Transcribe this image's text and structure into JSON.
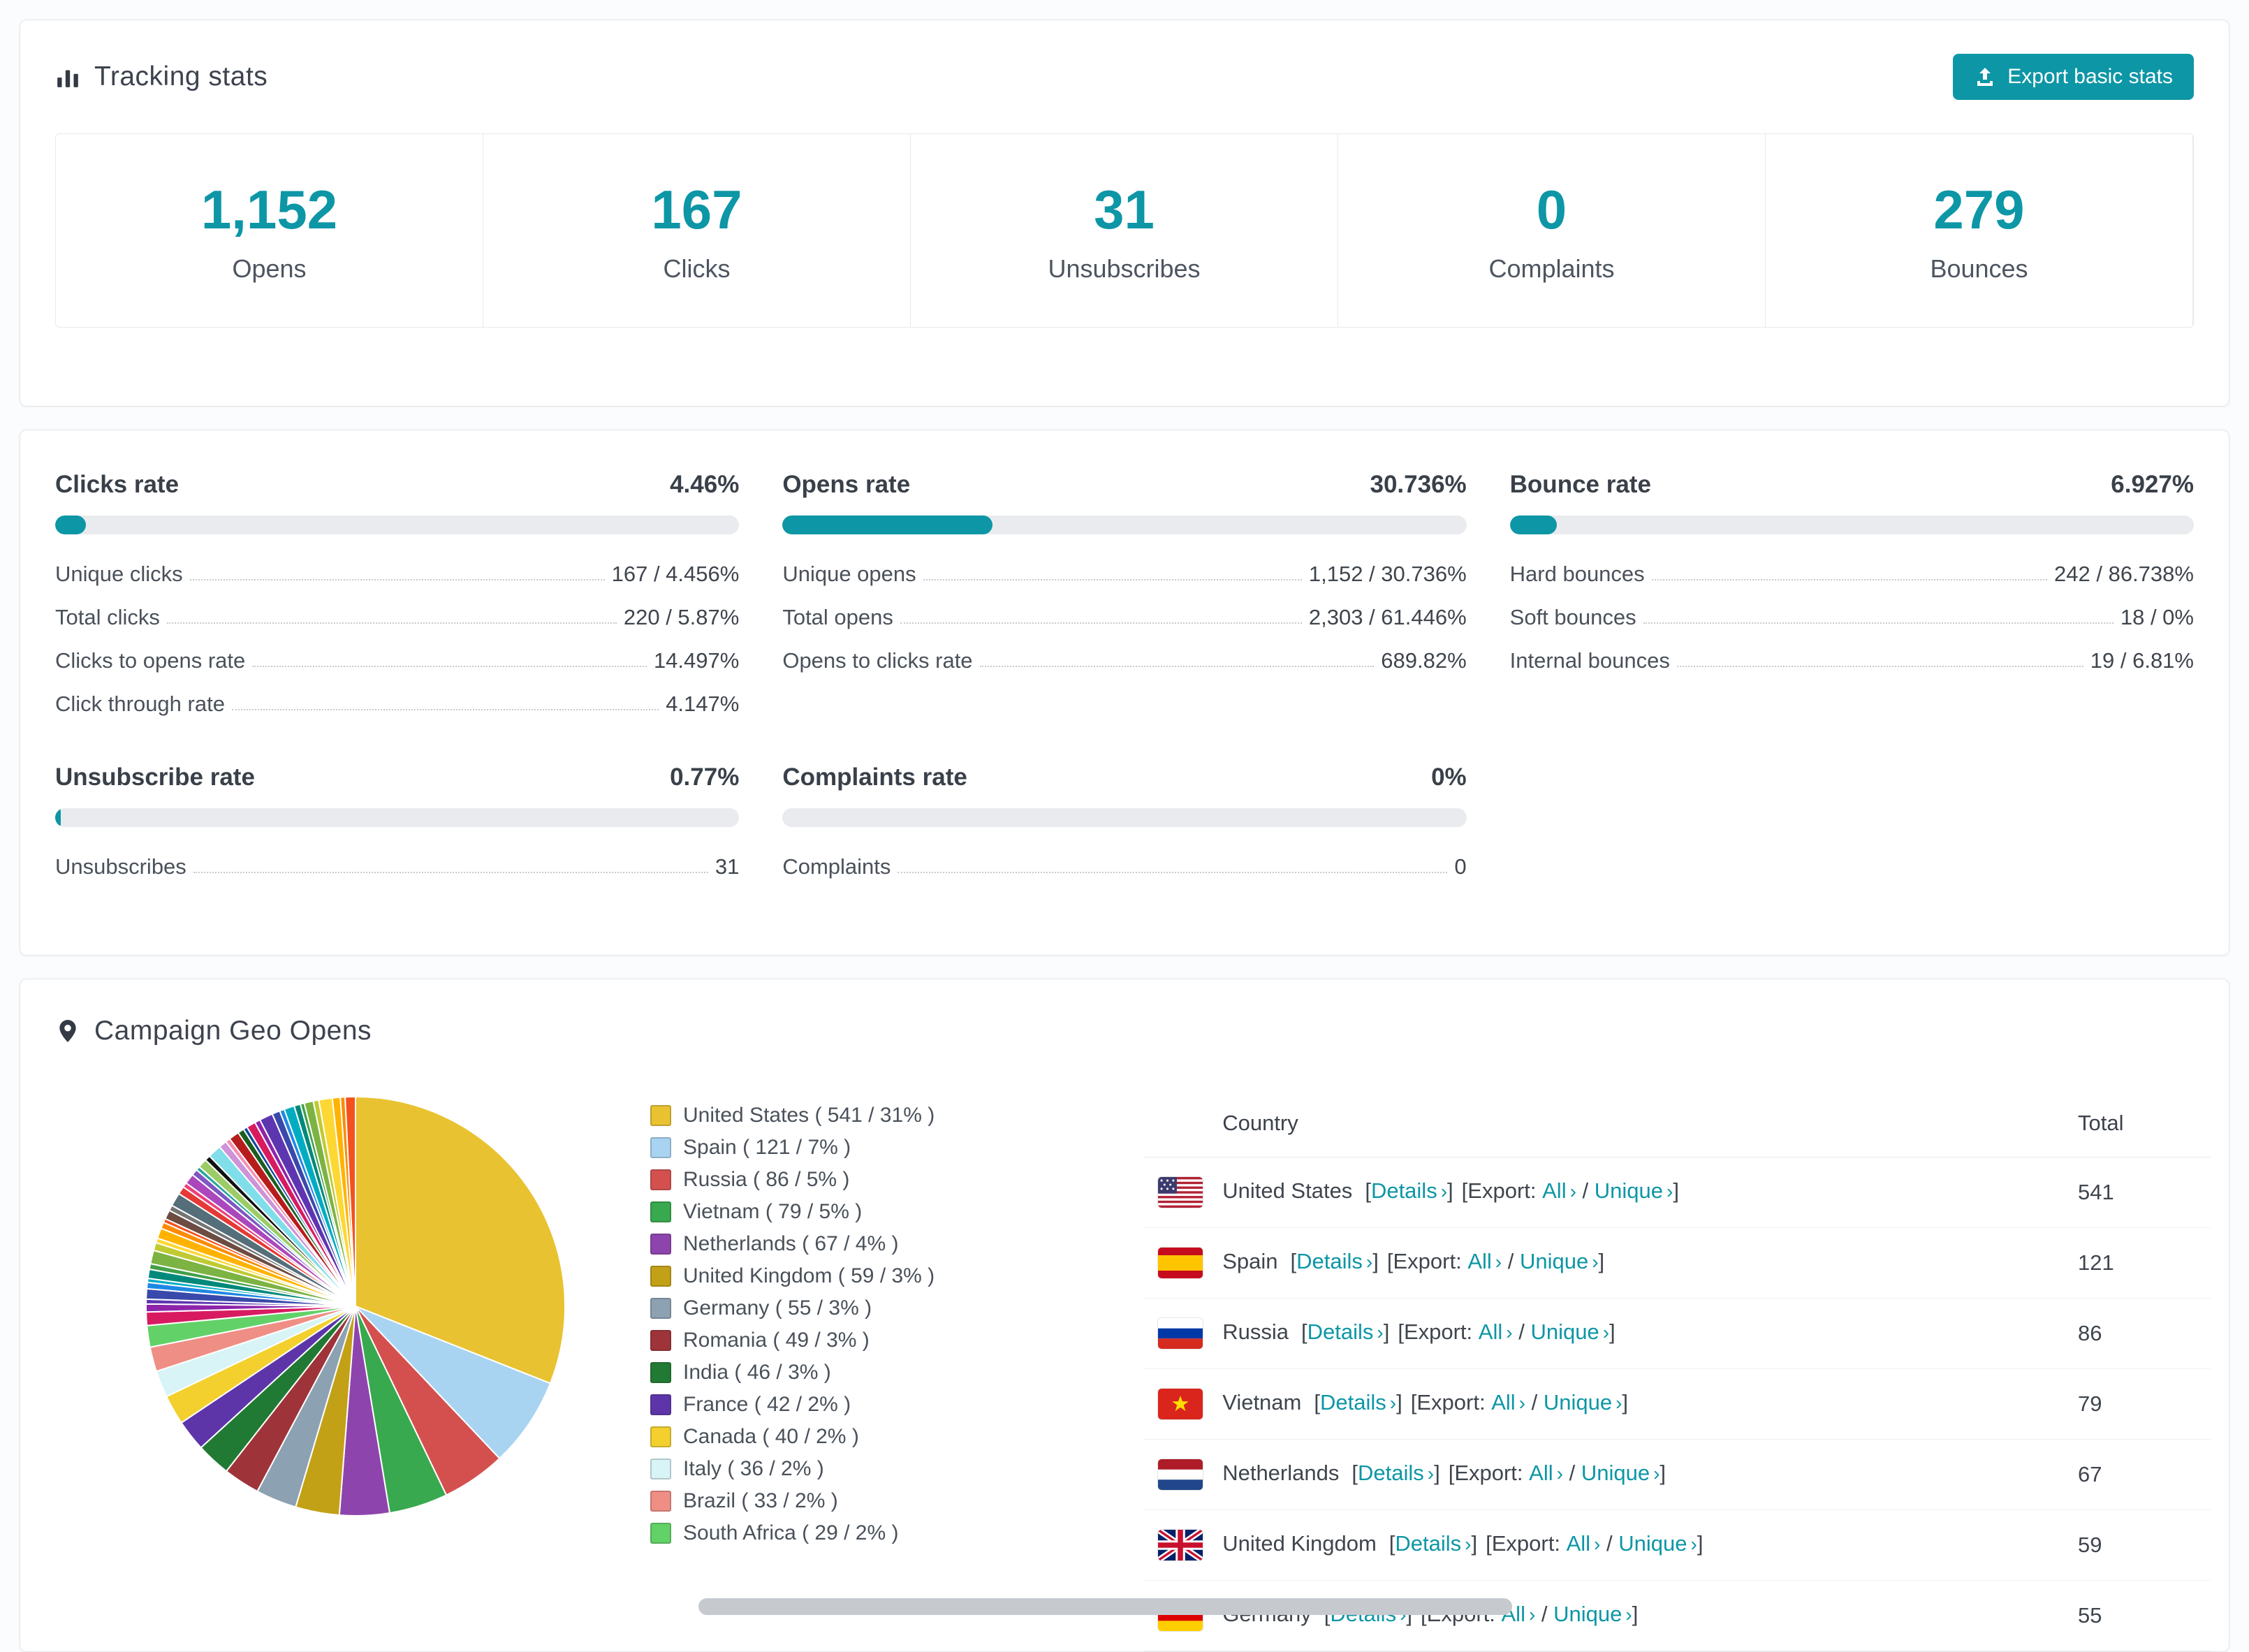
{
  "theme": {
    "accent": "#0d96a6"
  },
  "tracking": {
    "title": "Tracking stats",
    "export_button": "Export basic stats",
    "stats": [
      {
        "value": "1,152",
        "label": "Opens"
      },
      {
        "value": "167",
        "label": "Clicks"
      },
      {
        "value": "31",
        "label": "Unsubscribes"
      },
      {
        "value": "0",
        "label": "Complaints"
      },
      {
        "value": "279",
        "label": "Bounces"
      }
    ]
  },
  "rates": [
    {
      "title": "Clicks rate",
      "value": "4.46%",
      "pct": 4.46,
      "rows": [
        {
          "label": "Unique clicks",
          "value": "167 / 4.456%"
        },
        {
          "label": "Total clicks",
          "value": "220 / 5.87%"
        },
        {
          "label": "Clicks to opens rate",
          "value": "14.497%"
        },
        {
          "label": "Click through rate",
          "value": "4.147%"
        }
      ]
    },
    {
      "title": "Opens rate",
      "value": "30.736%",
      "pct": 30.736,
      "rows": [
        {
          "label": "Unique opens",
          "value": "1,152 / 30.736%"
        },
        {
          "label": "Total opens",
          "value": "2,303 / 61.446%"
        },
        {
          "label": "Opens to clicks rate",
          "value": "689.82%"
        }
      ]
    },
    {
      "title": "Bounce rate",
      "value": "6.927%",
      "pct": 6.927,
      "rows": [
        {
          "label": "Hard bounces",
          "value": "242 / 86.738%"
        },
        {
          "label": "Soft bounces",
          "value": "18 / 0%"
        },
        {
          "label": "Internal bounces",
          "value": "19 / 6.81%"
        }
      ]
    },
    {
      "title": "Unsubscribe rate",
      "value": "0.77%",
      "pct": 0.77,
      "rows": [
        {
          "label": "Unsubscribes",
          "value": "31"
        }
      ]
    },
    {
      "title": "Complaints rate",
      "value": "0%",
      "pct": 0,
      "rows": [
        {
          "label": "Complaints",
          "value": "0"
        }
      ]
    }
  ],
  "geo": {
    "title": "Campaign Geo Opens",
    "table": {
      "country_header": "Country",
      "total_header": "Total",
      "details_label": "Details",
      "export_label": "Export:",
      "all_label": "All",
      "unique_label": "Unique",
      "bracket_open": "[",
      "bracket_close": "]",
      "slash": "/",
      "rows": [
        {
          "flag": "us",
          "country": "United States",
          "total": "541"
        },
        {
          "flag": "es",
          "country": "Spain",
          "total": "121"
        },
        {
          "flag": "ru",
          "country": "Russia",
          "total": "86"
        },
        {
          "flag": "vn",
          "country": "Vietnam",
          "total": "79"
        },
        {
          "flag": "nl",
          "country": "Netherlands",
          "total": "67"
        },
        {
          "flag": "gb",
          "country": "United Kingdom",
          "total": "59"
        },
        {
          "flag": "de",
          "country": "Germany",
          "total": "55"
        }
      ]
    }
  },
  "chart_data": {
    "type": "pie",
    "title": "Campaign Geo Opens",
    "legend_position": "right",
    "series": [
      {
        "name": "United States",
        "value": 541,
        "pct": 31,
        "color": "#e9c231",
        "label": "United States ( 541 / 31% )"
      },
      {
        "name": "Spain",
        "value": 121,
        "pct": 7,
        "color": "#a9d4f1",
        "label": "Spain ( 121 / 7% )"
      },
      {
        "name": "Russia",
        "value": 86,
        "pct": 5,
        "color": "#d4504e",
        "label": "Russia ( 86 / 5% )"
      },
      {
        "name": "Vietnam",
        "value": 79,
        "pct": 5,
        "color": "#38a94e",
        "label": "Vietnam ( 79 / 5% )"
      },
      {
        "name": "Netherlands",
        "value": 67,
        "pct": 4,
        "color": "#8e44ad",
        "label": "Netherlands ( 67 / 4% )"
      },
      {
        "name": "United Kingdom",
        "value": 59,
        "pct": 3,
        "color": "#c3a117",
        "label": "United Kingdom ( 59 / 3% )"
      },
      {
        "name": "Germany",
        "value": 55,
        "pct": 3,
        "color": "#8ca1b2",
        "label": "Germany ( 55 / 3% )"
      },
      {
        "name": "Romania",
        "value": 49,
        "pct": 3,
        "color": "#9e3439",
        "label": "Romania ( 49 / 3% )"
      },
      {
        "name": "India",
        "value": 46,
        "pct": 3,
        "color": "#217a33",
        "label": "India ( 46 / 3% )"
      },
      {
        "name": "France",
        "value": 42,
        "pct": 2,
        "color": "#5d35a9",
        "label": "France ( 42 / 2% )"
      },
      {
        "name": "Canada",
        "value": 40,
        "pct": 2,
        "color": "#f3d02e",
        "label": "Canada ( 40 / 2% )"
      },
      {
        "name": "Italy",
        "value": 36,
        "pct": 2,
        "color": "#d8f4f6",
        "label": "Italy ( 36 / 2% )"
      },
      {
        "name": "Brazil",
        "value": 33,
        "pct": 2,
        "color": "#ef8e85",
        "label": "Brazil ( 33 / 2% )"
      },
      {
        "name": "South Africa",
        "value": 29,
        "pct": 2,
        "color": "#62d167",
        "label": "South Africa ( 29 / 2% )"
      }
    ],
    "others": {
      "total_value": 462,
      "slice_count": 44,
      "palette": [
        "#d81b60",
        "#8e24aa",
        "#5e35b1",
        "#3949ab",
        "#1e88e5",
        "#00acc1",
        "#00897b",
        "#43a047",
        "#7cb342",
        "#c0ca33",
        "#fdd835",
        "#ffb300",
        "#fb8c00",
        "#f4511e",
        "#6d4c41",
        "#757575",
        "#546e7a",
        "#e53935",
        "#ec407a",
        "#ab47bc",
        "#7e57c2",
        "#26a69a",
        "#9ccc65",
        "#111111",
        "#80deea",
        "#ce93d8",
        "#f48fb1",
        "#b71c1c",
        "#1b5e20",
        "#0d47a1"
      ]
    }
  }
}
